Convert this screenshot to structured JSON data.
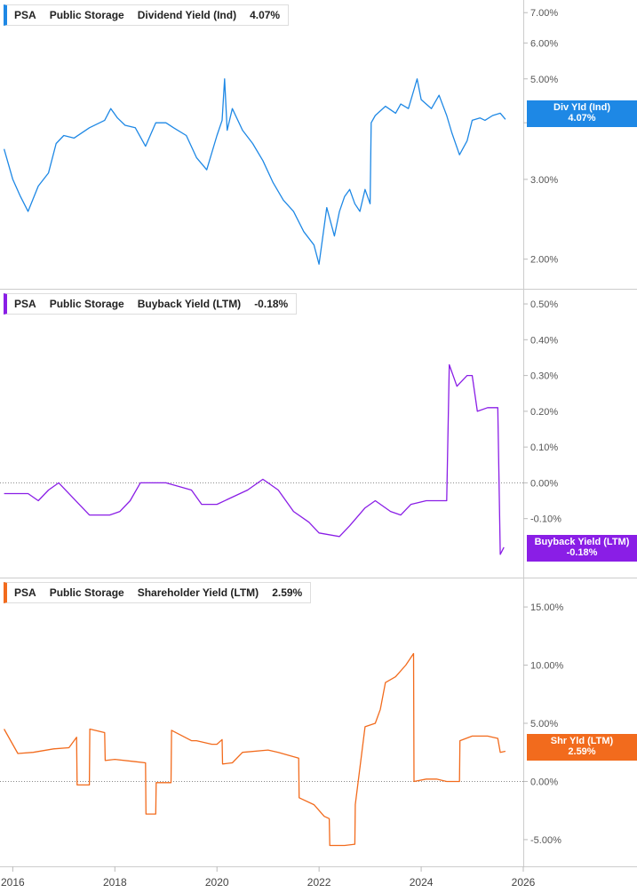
{
  "colors": {
    "dividend": "#1e88e5",
    "buyback": "#8a1ee6",
    "shareholder": "#f26b1d"
  },
  "panels": [
    {
      "ticker": "PSA",
      "company": "Public Storage",
      "metric": "Dividend Yield (Ind)",
      "value": "4.07%",
      "badge_label": "Div Yld (Ind)",
      "badge_value": "4.07%"
    },
    {
      "ticker": "PSA",
      "company": "Public Storage",
      "metric": "Buyback Yield (LTM)",
      "value": "-0.18%",
      "badge_label": "Buyback Yield (LTM)",
      "badge_value": "-0.18%"
    },
    {
      "ticker": "PSA",
      "company": "Public Storage",
      "metric": "Shareholder Yield (LTM)",
      "value": "2.59%",
      "badge_label": "Shr Yld (LTM)",
      "badge_value": "2.59%"
    }
  ],
  "chart_data": [
    {
      "type": "line",
      "title": "PSA Public Storage Dividend Yield (Ind) 4.07%",
      "series": [
        {
          "name": "Div Yld (Ind)",
          "x": [
            2015.83,
            2016.0,
            2016.15,
            2016.3,
            2016.5,
            2016.7,
            2016.85,
            2017.0,
            2017.2,
            2017.5,
            2017.8,
            2017.92,
            2018.05,
            2018.2,
            2018.4,
            2018.6,
            2018.8,
            2019.0,
            2019.15,
            2019.4,
            2019.6,
            2019.8,
            2020.0,
            2020.1,
            2020.15,
            2020.2,
            2020.3,
            2020.5,
            2020.7,
            2020.9,
            2021.1,
            2021.3,
            2021.5,
            2021.7,
            2021.9,
            2022.0,
            2022.15,
            2022.3,
            2022.4,
            2022.5,
            2022.6,
            2022.7,
            2022.8,
            2022.9,
            2023.0,
            2023.02,
            2023.1,
            2023.3,
            2023.5,
            2023.6,
            2023.75,
            2023.85,
            2023.92,
            2024.0,
            2024.2,
            2024.35,
            2024.5,
            2024.6,
            2024.75,
            2024.9,
            2025.0,
            2025.15,
            2025.25,
            2025.4,
            2025.55,
            2025.65
          ],
          "y": [
            3.5,
            3.0,
            2.75,
            2.55,
            2.9,
            3.1,
            3.6,
            3.75,
            3.7,
            3.9,
            4.05,
            4.3,
            4.1,
            3.95,
            3.9,
            3.55,
            4.0,
            4.0,
            3.9,
            3.75,
            3.35,
            3.15,
            3.75,
            4.05,
            5.0,
            3.85,
            4.3,
            3.85,
            3.6,
            3.3,
            2.95,
            2.7,
            2.55,
            2.3,
            2.15,
            1.95,
            2.6,
            2.25,
            2.55,
            2.75,
            2.85,
            2.65,
            2.55,
            2.85,
            2.65,
            4.0,
            4.15,
            4.35,
            4.2,
            4.4,
            4.3,
            4.7,
            5.0,
            4.5,
            4.3,
            4.6,
            4.15,
            3.8,
            3.4,
            3.65,
            4.05,
            4.1,
            4.05,
            4.15,
            4.2,
            4.07
          ]
        }
      ],
      "yticks": [
        "2.00%",
        "3.00%",
        "4.00%",
        "5.00%",
        "6.00%",
        "7.00%"
      ],
      "ylim": [
        1.8,
        7.2
      ],
      "yscale": "log",
      "grid": false,
      "legend": "top-left"
    },
    {
      "type": "line",
      "title": "PSA Public Storage Buyback Yield (LTM) -0.18%",
      "series": [
        {
          "name": "Buyback Yield (LTM)",
          "x": [
            2015.83,
            2016.3,
            2016.5,
            2016.7,
            2016.9,
            2017.3,
            2017.5,
            2017.9,
            2018.1,
            2018.3,
            2018.5,
            2019.0,
            2019.5,
            2019.7,
            2020.0,
            2020.3,
            2020.6,
            2020.9,
            2021.0,
            2021.2,
            2021.5,
            2021.8,
            2022.0,
            2022.4,
            2022.6,
            2022.9,
            2023.1,
            2023.4,
            2023.6,
            2023.8,
            2024.1,
            2024.5,
            2024.55,
            2024.7,
            2024.9,
            2025.0,
            2025.1,
            2025.3,
            2025.5,
            2025.55,
            2025.62
          ],
          "y": [
            -0.03,
            -0.03,
            -0.05,
            -0.02,
            0.0,
            -0.06,
            -0.09,
            -0.09,
            -0.08,
            -0.05,
            0.0,
            0.0,
            -0.02,
            -0.06,
            -0.06,
            -0.04,
            -0.02,
            0.01,
            0.0,
            -0.02,
            -0.08,
            -0.11,
            -0.14,
            -0.15,
            -0.12,
            -0.07,
            -0.05,
            -0.08,
            -0.09,
            -0.06,
            -0.05,
            -0.05,
            0.33,
            0.27,
            0.3,
            0.3,
            0.2,
            0.21,
            0.21,
            -0.2,
            -0.18
          ]
        }
      ],
      "yticks": [
        "-0.10%",
        "0.00%",
        "0.10%",
        "0.20%",
        "0.30%",
        "0.40%",
        "0.50%"
      ],
      "ylim": [
        -0.22,
        0.52
      ],
      "grid": false,
      "legend": "top-left"
    },
    {
      "type": "line",
      "title": "PSA Public Storage Shareholder Yield (LTM) 2.59%",
      "series": [
        {
          "name": "Shr Yld (LTM)",
          "x": [
            2015.83,
            2016.1,
            2016.4,
            2016.8,
            2017.1,
            2017.25,
            2017.26,
            2017.5,
            2017.51,
            2017.8,
            2017.81,
            2018.0,
            2018.4,
            2018.6,
            2018.61,
            2018.8,
            2018.81,
            2019.1,
            2019.11,
            2019.5,
            2019.6,
            2019.9,
            2020.0,
            2020.1,
            2020.11,
            2020.3,
            2020.5,
            2021.0,
            2021.2,
            2021.6,
            2021.61,
            2021.9,
            2022.1,
            2022.2,
            2022.21,
            2022.5,
            2022.7,
            2022.71,
            2022.9,
            2023.1,
            2023.2,
            2023.3,
            2023.5,
            2023.7,
            2023.85,
            2023.86,
            2024.1,
            2024.3,
            2024.5,
            2024.75,
            2024.76,
            2025.0,
            2025.3,
            2025.5,
            2025.55,
            2025.65
          ],
          "y": [
            4.5,
            2.4,
            2.5,
            2.8,
            2.9,
            3.8,
            -0.3,
            -0.3,
            4.5,
            4.2,
            1.8,
            1.9,
            1.7,
            1.6,
            -2.8,
            -2.8,
            -0.1,
            -0.1,
            4.4,
            3.5,
            3.5,
            3.2,
            3.2,
            3.6,
            1.5,
            1.6,
            2.5,
            2.7,
            2.5,
            2.0,
            -1.4,
            -2.0,
            -3.0,
            -3.2,
            -5.5,
            -5.5,
            -5.4,
            -2.0,
            4.7,
            5.0,
            6.2,
            8.5,
            9.0,
            10.0,
            11.0,
            0.0,
            0.2,
            0.2,
            0.0,
            0.0,
            3.5,
            3.9,
            3.9,
            3.7,
            2.5,
            2.59
          ]
        }
      ],
      "yticks": [
        "-5.00%",
        "0.00%",
        "5.00%",
        "10.00%",
        "15.00%"
      ],
      "ylim": [
        -6.0,
        16.0
      ],
      "grid": false,
      "legend": "top-left"
    }
  ],
  "x_axis": {
    "ticks": [
      2016,
      2018,
      2020,
      2022,
      2024,
      2026
    ],
    "tick_labels": [
      "2016",
      "2018",
      "2020",
      "2022",
      "2024",
      "2026"
    ],
    "xlim": [
      2015.75,
      2026.0
    ]
  }
}
